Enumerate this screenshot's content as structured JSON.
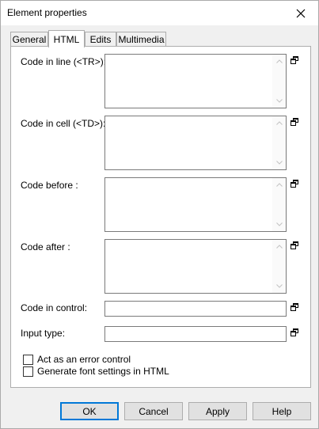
{
  "window": {
    "title": "Element properties"
  },
  "tabs": [
    {
      "label": "General"
    },
    {
      "label": "HTML"
    },
    {
      "label": "Edits"
    },
    {
      "label": "Multimedia"
    }
  ],
  "active_tab": "HTML",
  "fields": {
    "code_in_line": {
      "label": "Code in line (<TR>):",
      "value": ""
    },
    "code_in_cell": {
      "label": "Code in cell (<TD>):",
      "value": ""
    },
    "code_before": {
      "label": "Code before :",
      "value": ""
    },
    "code_after": {
      "label": "Code after :",
      "value": ""
    },
    "code_in_control": {
      "label": "Code in control:",
      "value": ""
    },
    "input_type": {
      "label": "Input type:",
      "value": ""
    }
  },
  "checkboxes": {
    "error_control": {
      "label": "Act as an error control",
      "checked": false
    },
    "font_settings": {
      "label": "Generate font settings in HTML",
      "checked": false
    }
  },
  "buttons": {
    "ok": "OK",
    "cancel": "Cancel",
    "apply": "Apply",
    "help": "Help"
  }
}
